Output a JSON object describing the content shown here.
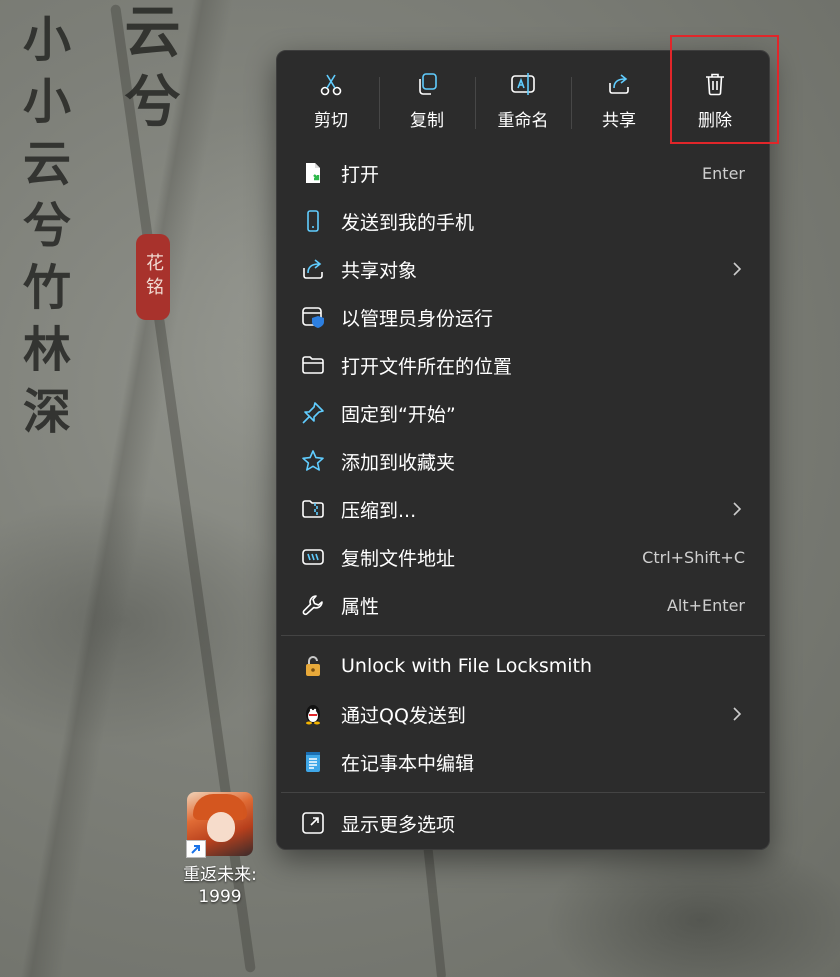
{
  "wallpaper": {
    "calligraphy_left": "小小云兮竹林深",
    "calligraphy_right": "云兮",
    "seal": "花铭"
  },
  "desktop_icon": {
    "label": "重返未来:\n1999"
  },
  "quick_actions": [
    {
      "label": "剪切",
      "icon": "scissors-icon"
    },
    {
      "label": "复制",
      "icon": "copy-icon"
    },
    {
      "label": "重命名",
      "icon": "rename-icon"
    },
    {
      "label": "共享",
      "icon": "share-icon"
    },
    {
      "label": "删除",
      "icon": "trash-icon",
      "highlighted": true
    }
  ],
  "menu_items": [
    {
      "label": "打开",
      "shortcut": "Enter",
      "icon": "open-file-icon"
    },
    {
      "label": "发送到我的手机",
      "icon": "phone-icon"
    },
    {
      "label": "共享对象",
      "icon": "share-icon",
      "submenu": true
    },
    {
      "label": "以管理员身份运行",
      "icon": "shield-icon"
    },
    {
      "label": "打开文件所在的位置",
      "icon": "folder-icon"
    },
    {
      "label": "固定到“开始”",
      "icon": "pin-icon"
    },
    {
      "label": "添加到收藏夹",
      "icon": "star-icon"
    },
    {
      "label": "压缩到...",
      "icon": "zip-folder-icon",
      "submenu": true
    },
    {
      "label": "复制文件地址",
      "shortcut": "Ctrl+Shift+C",
      "icon": "copy-path-icon"
    },
    {
      "label": "属性",
      "shortcut": "Alt+Enter",
      "icon": "wrench-icon"
    }
  ],
  "extension_items": [
    {
      "label": "Unlock with File Locksmith",
      "icon": "padlock-icon"
    },
    {
      "label": "通过QQ发送到",
      "icon": "qq-penguin-icon",
      "submenu": true
    },
    {
      "label": "在记事本中编辑",
      "icon": "notepad-icon"
    }
  ],
  "more_options": {
    "label": "显示更多选项",
    "icon": "expand-icon"
  },
  "colors": {
    "menu_bg": "#2c2c2c",
    "accent": "#60cdff",
    "highlight_border": "#e1262a"
  }
}
